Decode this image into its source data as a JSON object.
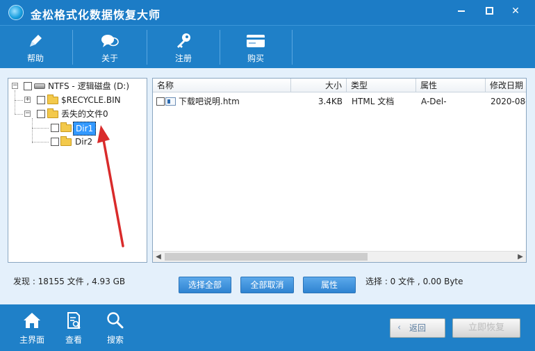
{
  "window": {
    "title": "金松格式化数据恢复大师"
  },
  "toolbar": {
    "items": [
      {
        "label": "帮助",
        "icon": "pen-icon"
      },
      {
        "label": "关于",
        "icon": "chat-bubble-icon"
      },
      {
        "label": "注册",
        "icon": "key-icon"
      },
      {
        "label": "购买",
        "icon": "cart-card-icon"
      }
    ]
  },
  "tree": {
    "root": "NTFS - 逻辑磁盘 (D:)",
    "nodes": [
      "$RECYCLE.BIN",
      "丢失的文件0",
      "Dir1",
      "Dir2"
    ],
    "selected": "Dir1"
  },
  "file_list": {
    "columns": [
      "名称",
      "大小",
      "类型",
      "属性",
      "修改日期"
    ],
    "rows": [
      {
        "name": "下载吧说明.htm",
        "size": "3.4KB",
        "type": "HTML 文档",
        "attr": "A-Del-",
        "modified": "2020-08-"
      }
    ]
  },
  "status": {
    "found": "发现 : 18155 文件 , 4.93 GB",
    "selection": "选择 : 0 文件 , 0.00 Byte"
  },
  "actions": {
    "select_all": "选择全部",
    "deselect_all": "全部取消",
    "properties": "属性"
  },
  "bottom_nav": {
    "items": [
      {
        "label": "主界面",
        "icon": "home-icon"
      },
      {
        "label": "查看",
        "icon": "document-search-icon"
      },
      {
        "label": "搜索",
        "icon": "magnifier-icon"
      }
    ],
    "back": "返回",
    "recover": "立即恢复"
  },
  "colors": {
    "titlebar": "#1c7cc6",
    "accent": "#2e83d1",
    "panel_bg": "#e4f0fb",
    "selection": "#3399ff",
    "annotation_arrow": "#d92b2b"
  }
}
